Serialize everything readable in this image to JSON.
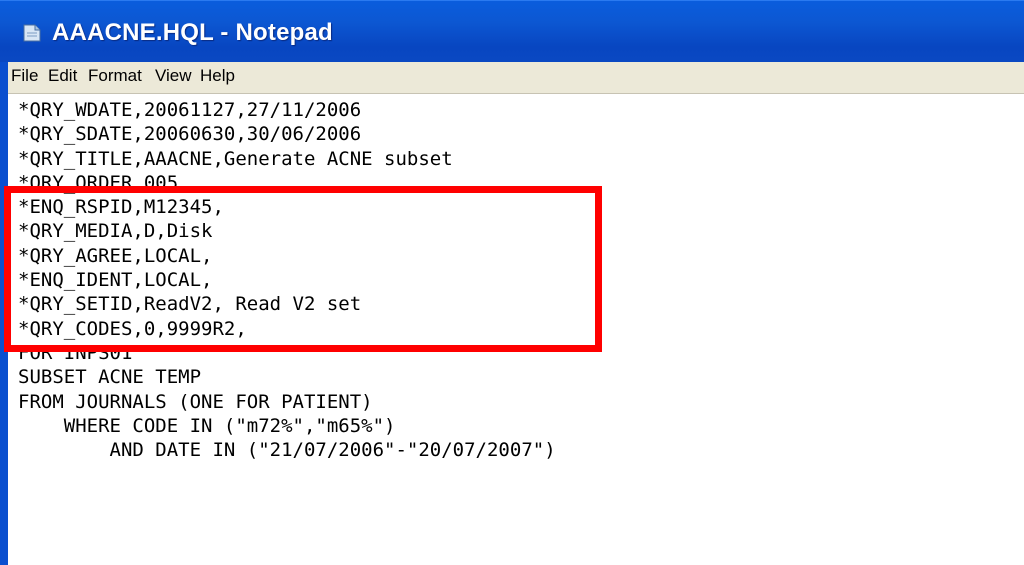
{
  "window": {
    "title": "AAACNE.HQL - Notepad",
    "icon": "notepad-icon"
  },
  "menu": {
    "items": [
      {
        "label": "File"
      },
      {
        "label": "Edit"
      },
      {
        "label": "Format"
      },
      {
        "label": "View"
      },
      {
        "label": "Help"
      }
    ]
  },
  "editor": {
    "lines": [
      "*QRY_WDATE,20061127,27/11/2006",
      "*QRY_SDATE,20060630,30/06/2006",
      "*QRY_TITLE,AAACNE,Generate ACNE subset",
      "*QRY_ORDER,005,",
      "*ENQ_RSPID,M12345,",
      "*QRY_MEDIA,D,Disk",
      "*QRY_AGREE,LOCAL,",
      "*ENQ_IDENT,LOCAL,",
      "*QRY_SETID,ReadV2, Read V2 set",
      "*QRY_CODES,0,9999R2,",
      "FOR INPS01",
      "SUBSET ACNE TEMP",
      "FROM JOURNALS (ONE FOR PATIENT)",
      "    WHERE CODE IN (\"m72%\",\"m65%\")",
      "        AND DATE IN (\"21/07/2006\"-\"20/07/2007\")"
    ]
  },
  "annotation": {
    "color": "#ff0000"
  },
  "colors": {
    "titlebar": "#0a4fcf",
    "menubar": "#ece9d8"
  }
}
